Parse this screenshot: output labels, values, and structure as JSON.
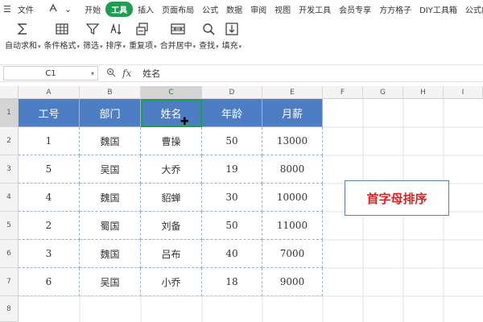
{
  "menubar": {
    "hamburger": "☰",
    "file": "文件",
    "items": [
      "开始",
      "工具",
      "插入",
      "页面布局",
      "公式",
      "数据",
      "审阅",
      "视图",
      "开发工具",
      "会员专享",
      "方方格子",
      "DIY工具箱",
      "公式向导"
    ],
    "active_index": 1,
    "accent": "#1f9d55"
  },
  "ribbon": {
    "buttons": [
      {
        "label": "自动求和",
        "icon": "sigma-icon"
      },
      {
        "label": "条件格式",
        "icon": "table-grid-icon"
      },
      {
        "label": "筛选",
        "icon": "funnel-icon"
      },
      {
        "label": "排序",
        "icon": "sort-icon"
      },
      {
        "label": "重复项",
        "icon": "duplicate-icon"
      },
      {
        "label": "合并居中",
        "icon": "merge-center-icon"
      },
      {
        "label": "查找",
        "icon": "search-icon"
      },
      {
        "label": "填充",
        "icon": "fill-down-icon"
      }
    ]
  },
  "formula_bar": {
    "name_box": "C1",
    "fx": "fx",
    "content": "姓名"
  },
  "sheet": {
    "columns": [
      "A",
      "B",
      "C",
      "D",
      "E",
      "F",
      "G",
      "H",
      "I"
    ],
    "selected_column": "C",
    "rows": [
      "1",
      "2",
      "3",
      "4",
      "5",
      "6",
      "7",
      "8"
    ],
    "selected_row": "1",
    "table_header": [
      "工号",
      "部门",
      "姓名",
      "年龄",
      "月薪"
    ],
    "table_rows": [
      [
        "1",
        "魏国",
        "曹操",
        "50",
        "13000"
      ],
      [
        "5",
        "吴国",
        "大乔",
        "19",
        "8000"
      ],
      [
        "4",
        "魏国",
        "貂蝉",
        "30",
        "10000"
      ],
      [
        "2",
        "蜀国",
        "刘备",
        "50",
        "11000"
      ],
      [
        "3",
        "魏国",
        "吕布",
        "40",
        "7000"
      ],
      [
        "6",
        "吴国",
        "小乔",
        "18",
        "9000"
      ]
    ],
    "header_color": "#4d7ec4",
    "note_text": "首字母排序",
    "note_color": "#e02020",
    "cursor_glyph": "✚"
  }
}
